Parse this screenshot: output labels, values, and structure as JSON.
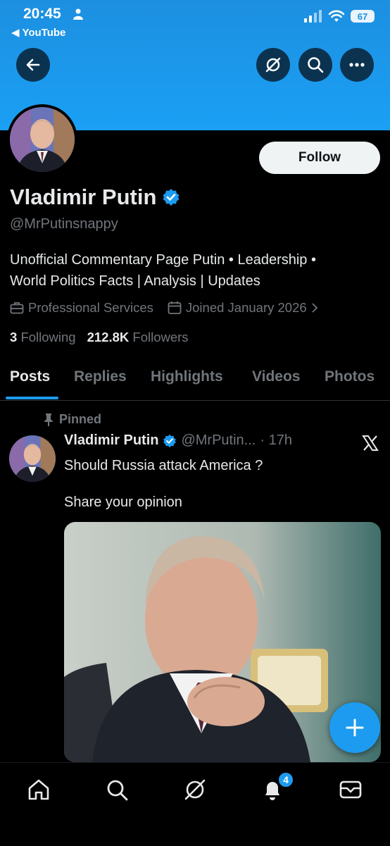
{
  "status_bar": {
    "time": "20:45",
    "back_app": "YouTube",
    "battery": "67"
  },
  "header": {
    "icons": [
      "back-arrow-icon",
      "grok-icon",
      "search-icon",
      "more-icon"
    ]
  },
  "profile": {
    "follow_label": "Follow",
    "name": "Vladimir Putin",
    "handle": "@MrPutinsnappy",
    "bio_line1": "Unofficial Commentary Page Putin • Leadership •",
    "bio_line2": "World Politics Facts | Analysis | Updates",
    "category": "Professional Services",
    "joined": "Joined January 2026",
    "following_count": "3",
    "following_label": "Following",
    "followers_count": "212.8K",
    "followers_label": "Followers"
  },
  "tabs": [
    "Posts",
    "Replies",
    "Highlights",
    "Videos",
    "Photos"
  ],
  "tweet": {
    "pinned_label": "Pinned",
    "name": "Vladimir Putin",
    "handle": "@MrPutin...",
    "time": "· 17h",
    "text_line1": "Should Russia attack America ?",
    "text_line2": "Share your opinion"
  },
  "bottom_nav": {
    "items": [
      "home-icon",
      "search-icon",
      "grok-icon",
      "notifications-icon",
      "messages-icon"
    ],
    "notification_count": "4"
  },
  "colors": {
    "accent": "#1d9bf0",
    "banner": "#1aa0f5",
    "background": "#000000",
    "secondary_text": "#71767b"
  }
}
